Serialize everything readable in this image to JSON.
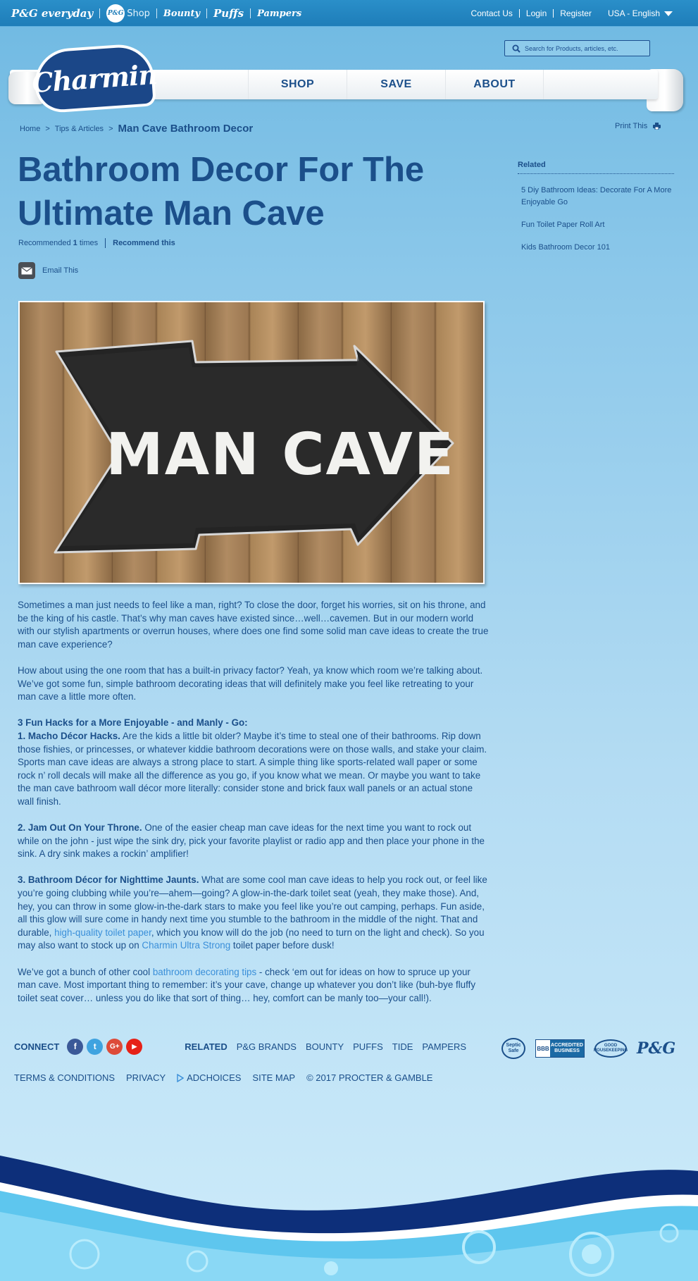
{
  "brand_bar": {
    "brands": [
      "P&G everyday",
      "P&G",
      "Shop",
      "Bounty",
      "Puffs",
      "Pampers"
    ],
    "links": [
      "Contact Us",
      "Login",
      "Register"
    ],
    "language": "USA - English"
  },
  "search": {
    "placeholder": "Search for Products, articles, etc."
  },
  "logo": "Charmin",
  "nav": [
    "SHOP",
    "SAVE",
    "ABOUT"
  ],
  "breadcrumb": {
    "home": "Home",
    "section": "Tips & Articles",
    "current": "Man Cave Bathroom Decor"
  },
  "print": "Print This",
  "article": {
    "title": "Bathroom Decor For The Ultimate Man Cave",
    "recommended_prefix": "Recommended",
    "recommended_count": "1",
    "recommended_suffix": "times",
    "recommend_link": "Recommend this",
    "email": "Email This",
    "image_text": "MAN CAVE",
    "p1": "Sometimes a man just needs to feel like a man, right? To close the door, forget his worries, sit on his throne, and be the king of his castle. That’s why man caves have existed since…well…cavemen. But in our modern world with our stylish apartments or overrun houses, where does one find some solid man cave ideas to create the true man cave experience?",
    "p2": "How about using the one room that has a built-in privacy factor? Yeah, ya know which room we’re talking about. We’ve got some fun, simple bathroom decorating ideas that will definitely make you feel like retreating to your man cave a little more often.",
    "h1": "3 Fun Hacks for a More Enjoyable - and Manly - Go:",
    "hack1_title": "1. Macho Décor Hacks.",
    "hack1_text": " Are the kids a little bit older? Maybe it’s time to steal one of their bathrooms. Rip down those fishies, or princesses, or whatever kiddie bathroom decorations were on those walls, and stake your claim. Sports man cave ideas are always a strong place to start. A simple thing like sports-related wall paper or some rock n’ roll decals will make all the difference as you go, if you know what we mean. Or maybe you want to take the man cave bathroom wall décor more literally: consider stone and brick faux wall panels or an actual stone wall finish.",
    "hack2_title": "2. Jam Out On Your Throne.",
    "hack2_text": " One of the easier cheap man cave ideas for the next time you want to rock out while on the john - just wipe the sink dry, pick your favorite playlist or radio app and then place your phone in the sink. A dry sink makes a rockin’ amplifier!",
    "hack3_title": "3. Bathroom Décor for Nighttime Jaunts.",
    "hack3_text_a": " What are some cool man cave ideas to help you rock out, or feel like you’re going clubbing while you’re—ahem—going? A glow-in-the-dark toilet seat (yeah, they make those). And, hey, you can throw in some glow-in-the-dark stars to make you feel like you’re out camping, perhaps. Fun aside, all this glow will sure come in handy next time you stumble to the bathroom in the middle of the night. That and durable, ",
    "hack3_link1": "high-quality toilet paper",
    "hack3_text_b": ", which you know will do the job (no need to turn on the light and check). So you may also want to stock up on ",
    "hack3_link2": "Charmin Ultra Strong",
    "hack3_text_c": " toilet paper before dusk!",
    "p_last_a": "We’ve got a bunch of other cool ",
    "p_last_link": "bathroom decorating tips",
    "p_last_b": " - check  ‘em out for ideas on how to spruce up your man cave. Most important thing to remember: it’s your cave, change up whatever you don’t like (buh-bye fluffy toilet seat cover… unless you do like that sort of thing… hey, comfort can be manly too—your call!)."
  },
  "related": {
    "heading": "Related",
    "items": [
      "5 Diy Bathroom Ideas: Decorate For A More Enjoyable Go",
      "Fun Toilet Paper Roll Art",
      "Kids Bathroom Decor 101"
    ]
  },
  "footer": {
    "connect": "CONNECT",
    "social": [
      {
        "icon": "facebook-icon",
        "glyph": "f",
        "color": "#3b5998"
      },
      {
        "icon": "twitter-icon",
        "glyph": "t",
        "color": "#3fa3e0"
      },
      {
        "icon": "google-plus-icon",
        "glyph": "G+",
        "color": "#dd4b39"
      },
      {
        "icon": "youtube-icon",
        "glyph": "▶",
        "color": "#e62117"
      }
    ],
    "related_label": "RELATED",
    "related_links": [
      "P&G BRANDS",
      "BOUNTY",
      "PUFFS",
      "TIDE",
      "PAMPERS"
    ],
    "badges": {
      "septic": "Septic Safe",
      "bbb_left": "BBB",
      "bbb_right": "ACCREDITED BUSINESS",
      "good_housekeeping": "GOOD HOUSEKEEPING",
      "pg": "P&G"
    },
    "bottom_links": [
      "TERMS & CONDITIONS",
      "PRIVACY",
      "ADCHOICES",
      "SITE MAP"
    ],
    "copyright": "© 2017 PROCTER & GAMBLE"
  },
  "colors": {
    "primary": "#1b4f8a",
    "link": "#3a8fd9",
    "brand_bar": "#1e7db9",
    "wave_dark": "#0d2f7a"
  }
}
